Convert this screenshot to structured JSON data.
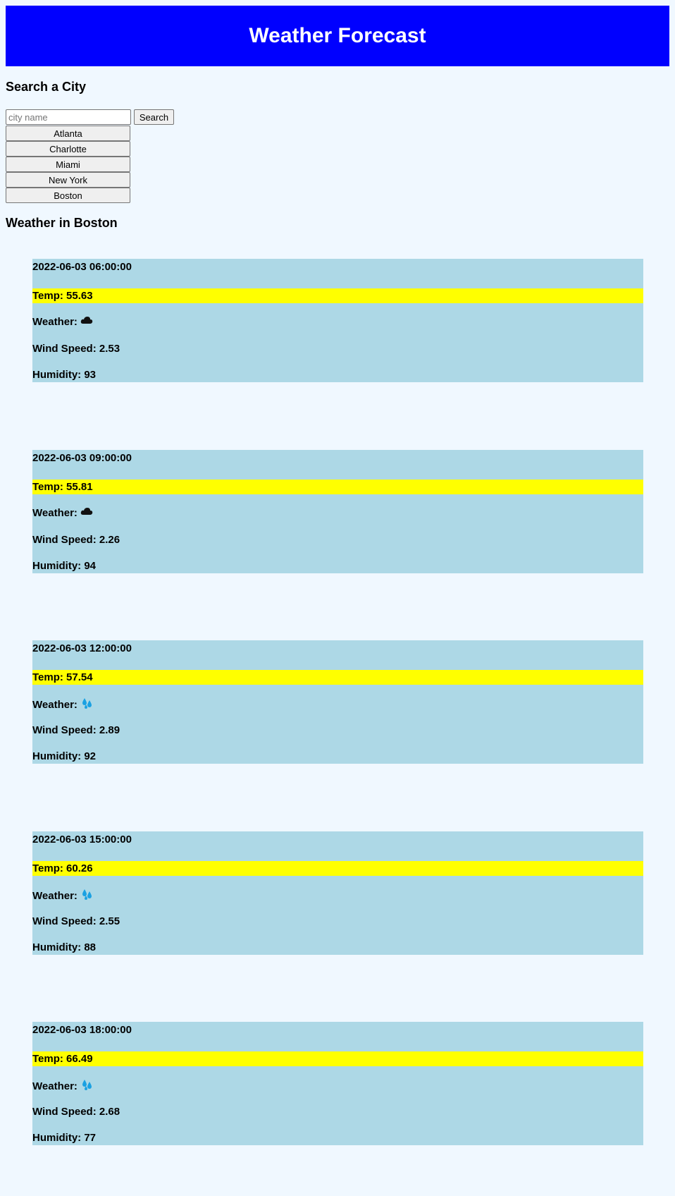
{
  "header": {
    "title": "Weather Forecast"
  },
  "search": {
    "heading": "Search a City",
    "placeholder": "city name",
    "value": "",
    "button_label": "Search"
  },
  "cities": [
    "Atlanta",
    "Charlotte",
    "Miami",
    "New York",
    "Boston"
  ],
  "weather_heading": "Weather in Boston",
  "forecasts": [
    {
      "date": "2022-06-03 06:00:00",
      "temp": "Temp: 55.63",
      "weather_label": "Weather:",
      "icon": "cloud-icon",
      "wind": "Wind Speed: 2.53",
      "humidity": "Humidity: 93"
    },
    {
      "date": "2022-06-03 09:00:00",
      "temp": "Temp: 55.81",
      "weather_label": "Weather:",
      "icon": "cloud-icon",
      "wind": "Wind Speed: 2.26",
      "humidity": "Humidity: 94"
    },
    {
      "date": "2022-06-03 12:00:00",
      "temp": "Temp: 57.54",
      "weather_label": "Weather:",
      "icon": "rain-drops-icon",
      "wind": "Wind Speed: 2.89",
      "humidity": "Humidity: 92"
    },
    {
      "date": "2022-06-03 15:00:00",
      "temp": "Temp: 60.26",
      "weather_label": "Weather:",
      "icon": "rain-drops-icon",
      "wind": "Wind Speed: 2.55",
      "humidity": "Humidity: 88"
    },
    {
      "date": "2022-06-03 18:00:00",
      "temp": "Temp: 66.49",
      "weather_label": "Weather:",
      "icon": "rain-drops-icon",
      "wind": "Wind Speed: 2.68",
      "humidity": "Humidity: 77"
    }
  ],
  "colors": {
    "header_bg": "#0000ff",
    "page_bg": "#f0f8ff",
    "card_bg": "#add8e6",
    "temp_highlight": "#ffff00"
  }
}
